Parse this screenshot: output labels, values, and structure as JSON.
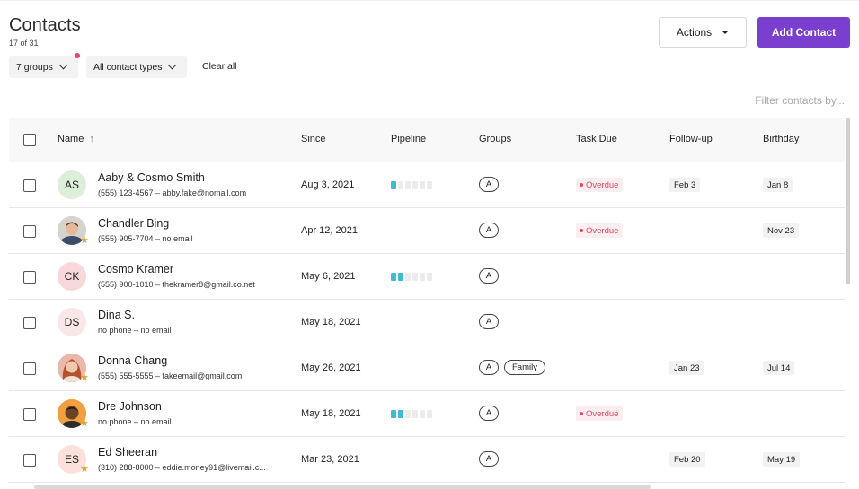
{
  "header": {
    "title": "Contacts",
    "count": "17 of 31",
    "actions_label": "Actions",
    "add_label": "Add Contact"
  },
  "filters": {
    "groups_label": "7 groups",
    "types_label": "All contact types",
    "clear_label": "Clear all",
    "search_placeholder": "Filter contacts by..."
  },
  "columns": {
    "name": "Name",
    "since": "Since",
    "pipeline": "Pipeline",
    "groups": "Groups",
    "task_due": "Task Due",
    "followup": "Follow-up",
    "birthday": "Birthday"
  },
  "colors": {
    "accent": "#7a3fce",
    "pipeline_active": "#3fbcd2",
    "overdue": "#e0485f",
    "star": "#e2a12d"
  },
  "rows": [
    {
      "name": "Aaby & Cosmo Smith",
      "sub": "(555) 123-4567 – abby.fake@nomail.com",
      "since": "Aug 3, 2021",
      "initials": "AS",
      "avatar_color": "#dcefd9",
      "starred": false,
      "photo": false,
      "pipeline": 1,
      "groups": [
        "A"
      ],
      "task": "Overdue",
      "followup": "Feb 3",
      "birthday": "Jan 8"
    },
    {
      "name": "Chandler Bing",
      "sub": "(555) 905-7704 – no email",
      "since": "Apr 12, 2021",
      "initials": "",
      "avatar_color": "#d9d4cf",
      "starred": true,
      "photo": true,
      "pipeline": 0,
      "groups": [
        "A"
      ],
      "task": "Overdue",
      "followup": "",
      "birthday": "Nov 23"
    },
    {
      "name": "Cosmo Kramer",
      "sub": "(555) 900-1010 – thekramer8@gmail.co.net",
      "since": "May 6, 2021",
      "initials": "CK",
      "avatar_color": "#f8d8d8",
      "starred": false,
      "photo": false,
      "pipeline": 2,
      "groups": [
        "A"
      ],
      "task": "",
      "followup": "",
      "birthday": ""
    },
    {
      "name": "Dina S.",
      "sub": "no phone – no email",
      "since": "May 18, 2021",
      "initials": "DS",
      "avatar_color": "#fbe6e8",
      "starred": false,
      "photo": false,
      "pipeline": 0,
      "groups": [
        "A"
      ],
      "task": "",
      "followup": "",
      "birthday": ""
    },
    {
      "name": "Donna Chang",
      "sub": "(555) 555-5555 – fakeemail@gmail.com",
      "since": "May 26, 2021",
      "initials": "",
      "avatar_color": "#e8b5a8",
      "starred": true,
      "photo": true,
      "pipeline": 0,
      "groups": [
        "A",
        "Family"
      ],
      "task": "",
      "followup": "Jan 23",
      "birthday": "Jul 14"
    },
    {
      "name": "Dre Johnson",
      "sub": "no phone – no email",
      "since": "May 18, 2021",
      "initials": "",
      "avatar_color": "#f0a040",
      "starred": true,
      "photo": true,
      "pipeline": 2,
      "groups": [
        "A"
      ],
      "task": "Overdue",
      "followup": "",
      "birthday": ""
    },
    {
      "name": "Ed Sheeran",
      "sub": "(310) 288-8000 – eddie.money91@livemail.c...",
      "since": "Mar 23, 2021",
      "initials": "ES",
      "avatar_color": "#fbe0dc",
      "starred": true,
      "photo": false,
      "pipeline": 0,
      "groups": [
        "A"
      ],
      "task": "",
      "followup": "Feb 20",
      "birthday": "May 19"
    }
  ]
}
